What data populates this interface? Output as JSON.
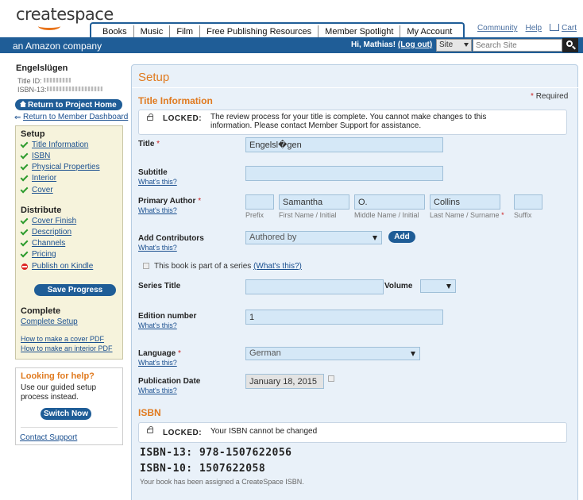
{
  "header": {
    "logo_text": "createspace",
    "tagline": "an Amazon company",
    "nav_tabs": [
      "Books",
      "Music",
      "Film",
      "Free Publishing Resources",
      "Member Spotlight",
      "My Account"
    ],
    "top_links": {
      "community": "Community",
      "help": "Help",
      "cart": "Cart"
    },
    "greeting": "Hi, Mathias!",
    "logout": "(Log out)",
    "site_select": "Site",
    "search_placeholder": "Search Site"
  },
  "sidebar": {
    "title_name": "Engelslügen",
    "title_id_label": "Title ID:",
    "isbn13_label": "ISBN-13:",
    "return_project": "Return to Project Home",
    "return_dashboard": "Return to Member Dashboard",
    "setup_head": "Setup",
    "setup_items": [
      "Title Information",
      "ISBN",
      "Physical Properties",
      "Interior",
      "Cover"
    ],
    "distribute_head": "Distribute",
    "distribute_items": [
      "Cover Finish",
      "Description",
      "Channels",
      "Pricing",
      "Publish on Kindle"
    ],
    "save_progress": "Save Progress",
    "complete_head": "Complete",
    "complete_link": "Complete Setup",
    "pdf_cover": "How to make a cover PDF",
    "pdf_interior": "How to make an interior PDF"
  },
  "help": {
    "title": "Looking for help?",
    "text": "Use our guided setup process instead.",
    "switch": "Switch Now",
    "contact": "Contact Support"
  },
  "main": {
    "title": "Setup",
    "section_title": "Title Information",
    "required": "Required",
    "locked_label": "LOCKED:",
    "locked_msg": "The review process for your title is complete. You cannot make changes to this information. Please contact Member Support for assistance.",
    "whats_this": "What's this?",
    "title_label": "Title",
    "title_value": "Engelsl�gen",
    "subtitle_label": "Subtitle",
    "subtitle_value": "",
    "author_label": "Primary Author",
    "author": {
      "prefix": "",
      "first": "Samantha",
      "middle": "O.",
      "last": "Collins",
      "suffix": "",
      "prefix_lbl": "Prefix",
      "first_lbl": "First Name / Initial",
      "middle_lbl": "Middle Name / Initial",
      "last_lbl": "Last Name / Surname",
      "suffix_lbl": "Suffix"
    },
    "contributors_label": "Add Contributors",
    "contributors_select": "Authored by",
    "add_button": "Add",
    "series_text": "This book is part of a series",
    "series_whats": "(What's this?)",
    "series_title_label": "Series Title",
    "volume_label": "Volume",
    "edition_label": "Edition number",
    "edition_value": "1",
    "language_label": "Language",
    "language_value": "German",
    "pubdate_label": "Publication Date",
    "pubdate_value": "January 18, 2015",
    "isbn_section": "ISBN",
    "isbn_locked_msg": "Your ISBN cannot be changed",
    "isbn13": "ISBN-13: 978-1507622056",
    "isbn10": "ISBN-10: 1507622058",
    "isbn_note": "Your book has been assigned a CreateSpace ISBN."
  }
}
